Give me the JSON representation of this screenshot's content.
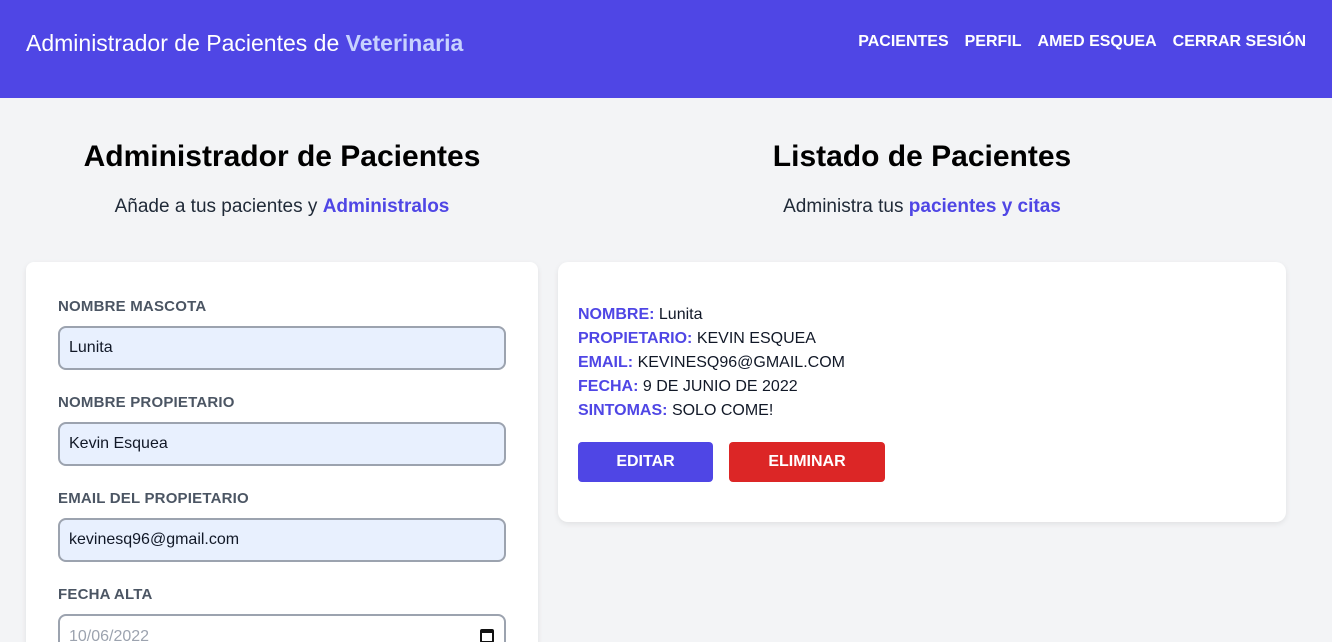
{
  "header": {
    "title_prefix": "Administrador de Pacientes de ",
    "title_highlight": "Veterinaria",
    "nav": [
      "PACIENTES",
      "PERFIL",
      "AMED ESQUEA",
      "CERRAR SESIÓN"
    ]
  },
  "left": {
    "heading": "Administrador de Pacientes",
    "subtitle_prefix": "Añade a tus pacientes y ",
    "subtitle_accent": "Administralos"
  },
  "right": {
    "heading": "Listado de Pacientes",
    "subtitle_prefix": "Administra tus ",
    "subtitle_accent": "pacientes y citas"
  },
  "form": {
    "pet_name_label": "NOMBRE MASCOTA",
    "pet_name_value": "Lunita",
    "owner_label": "NOMBRE PROPIETARIO",
    "owner_value": "Kevin Esquea",
    "email_label": "EMAIL DEL PROPIETARIO",
    "email_value": "kevinesq96@gmail.com",
    "date_label": "FECHA ALTA",
    "date_value": "10/06/2022"
  },
  "patient": {
    "name_label": "NOMBRE:",
    "name_value": "Lunita",
    "owner_label": "PROPIETARIO:",
    "owner_value": "KEVIN ESQUEA",
    "email_label": "EMAIL:",
    "email_value": "KEVINESQ96@GMAIL.COM",
    "date_label": "FECHA:",
    "date_value": "9 DE JUNIO DE 2022",
    "symptoms_label": "SINTOMAS:",
    "symptoms_value": "SOLO COME!",
    "edit_label": "EDITAR",
    "delete_label": "ELIMINAR"
  },
  "colors": {
    "primary": "#4f46e5",
    "danger": "#dc2626",
    "background": "#f3f4f6"
  }
}
